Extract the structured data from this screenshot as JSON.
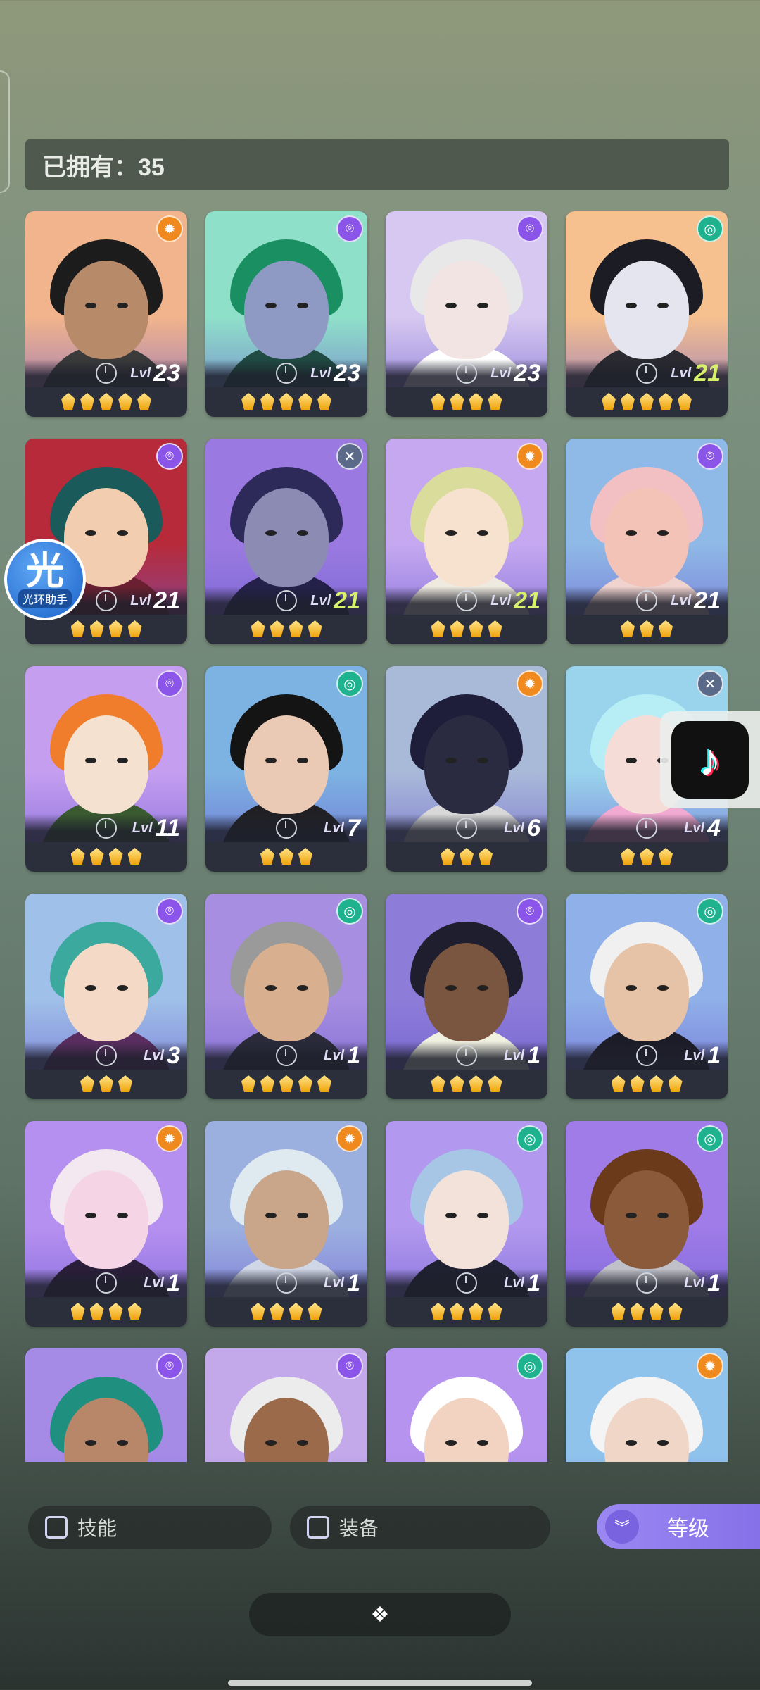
{
  "header": {
    "owned_label": "已拥有：35"
  },
  "characters": [
    {
      "level": "23",
      "stars": 5,
      "element": "orange",
      "bg": "#f2b48c",
      "hair": "#1c1c1c",
      "skin": "#b78a6a",
      "body": "#3a3a3a",
      "green": false
    },
    {
      "level": "23",
      "stars": 5,
      "element": "purple",
      "bg": "#8fe0c9",
      "hair": "#1a8f62",
      "skin": "#8e9ac4",
      "body": "#1f4b42",
      "green": false
    },
    {
      "level": "23",
      "stars": 4,
      "element": "purple",
      "bg": "#d6c8f0",
      "hair": "#e8e8e8",
      "skin": "#f3e4e4",
      "body": "#ffffff",
      "green": false
    },
    {
      "level": "21",
      "stars": 5,
      "element": "teal",
      "bg": "#f6c08f",
      "hair": "#1c1c24",
      "skin": "#e5e5ef",
      "body": "#2a2a30",
      "green": true
    },
    {
      "level": "21",
      "stars": 4,
      "element": "purple",
      "bg": "#b62a3a",
      "hair": "#1a5a5a",
      "skin": "#f2cdb0",
      "body": "#6a2030",
      "green": false
    },
    {
      "level": "21",
      "stars": 4,
      "element": "grey",
      "bg": "#9a7ae0",
      "hair": "#2d2a5a",
      "skin": "#8b8bb3",
      "body": "#24204a",
      "green": true
    },
    {
      "level": "21",
      "stars": 4,
      "element": "orange",
      "bg": "#c5a8f0",
      "hair": "#d9dc9a",
      "skin": "#f7e2cf",
      "body": "#efeadf",
      "green": true
    },
    {
      "level": "21",
      "stars": 3,
      "element": "purple",
      "bg": "#8fb9e6",
      "hair": "#f2c0c2",
      "skin": "#f2c3b6",
      "body": "#f0d3cf",
      "green": false
    },
    {
      "level": "11",
      "stars": 4,
      "element": "purple",
      "bg": "#c59ef0",
      "hair": "#f07d2b",
      "skin": "#f5e1d0",
      "body": "#3a5a30",
      "green": false
    },
    {
      "level": "7",
      "stars": 3,
      "element": "teal",
      "bg": "#7db3e2",
      "hair": "#141414",
      "skin": "#eac9b5",
      "body": "#202024",
      "green": false
    },
    {
      "level": "6",
      "stars": 3,
      "element": "orange",
      "bg": "#a9b9d8",
      "hair": "#1e1e3a",
      "skin": "#2a2a40",
      "body": "#d8d8d8",
      "green": false
    },
    {
      "level": "4",
      "stars": 3,
      "element": "grey",
      "bg": "#9ad4ec",
      "hair": "#b7eef5",
      "skin": "#f6dcd7",
      "body": "#f2a9d2",
      "green": false
    },
    {
      "level": "3",
      "stars": 3,
      "element": "purple",
      "bg": "#9fc0e8",
      "hair": "#3ca99e",
      "skin": "#f4d9c7",
      "body": "#5a2d60",
      "green": false
    },
    {
      "level": "1",
      "stars": 5,
      "element": "teal",
      "bg": "#a78ee0",
      "hair": "#9a9a9a",
      "skin": "#d8b090",
      "body": "#2a2a3a",
      "green": false
    },
    {
      "level": "1",
      "stars": 4,
      "element": "purple",
      "bg": "#8d7cd8",
      "hair": "#1e1e2e",
      "skin": "#7a5540",
      "body": "#f0f0e0",
      "green": false
    },
    {
      "level": "1",
      "stars": 4,
      "element": "teal",
      "bg": "#8fb0e8",
      "hair": "#f0f0f0",
      "skin": "#e6c2a6",
      "body": "#1c1c28",
      "green": false
    },
    {
      "level": "1",
      "stars": 4,
      "element": "orange",
      "bg": "#b690f0",
      "hair": "#f3e8f0",
      "skin": "#f5d5e5",
      "body": "#2a1e3a",
      "green": false
    },
    {
      "level": "1",
      "stars": 4,
      "element": "orange",
      "bg": "#9cb0e0",
      "hair": "#dfe9f0",
      "skin": "#c9a58a",
      "body": "#cfd6e6",
      "green": false
    },
    {
      "level": "1",
      "stars": 4,
      "element": "teal",
      "bg": "#b298ee",
      "hair": "#a7c6e6",
      "skin": "#f2e2d9",
      "body": "#1f2030",
      "green": false
    },
    {
      "level": "1",
      "stars": 4,
      "element": "teal",
      "bg": "#9f7ce8",
      "hair": "#6a3a1a",
      "skin": "#8a5a3a",
      "body": "#c0c0c8",
      "green": false
    },
    {
      "level": "",
      "stars": 0,
      "element": "purple",
      "bg": "#a58ae6",
      "hair": "#1f8f80",
      "skin": "#b8876a",
      "body": "#2a3a3a",
      "green": false
    },
    {
      "level": "",
      "stars": 0,
      "element": "purple",
      "bg": "#c3a9ea",
      "hair": "#ececec",
      "skin": "#9a6a4a",
      "body": "#e0d8f0",
      "green": false
    },
    {
      "level": "",
      "stars": 0,
      "element": "teal",
      "bg": "#b593ee",
      "hair": "#ffffff",
      "skin": "#f2d3c2",
      "body": "#2a2a2a",
      "green": false
    },
    {
      "level": "",
      "stars": 0,
      "element": "orange",
      "bg": "#8fc3ec",
      "hair": "#f4f4f4",
      "skin": "#f0d6c6",
      "body": "#ffffff",
      "green": false
    }
  ],
  "level_prefix": "Lvl",
  "filters": {
    "skill_label": "技能",
    "equip_label": "装备",
    "level_label": "等级"
  },
  "overlays": {
    "assistant_char": "光",
    "assistant_name": "光环助手"
  },
  "element_colors": {
    "orange": "#f08a1e",
    "purple": "#8a55e8",
    "teal": "#1fb28f",
    "grey": "#5c6a8a"
  }
}
